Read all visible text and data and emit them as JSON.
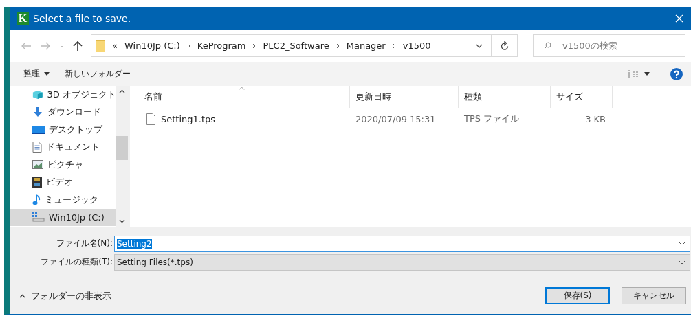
{
  "window": {
    "title": "Select a file to save.",
    "app_icon_letter": "K"
  },
  "address_bar": {
    "overflow": "«",
    "crumbs": [
      "Win10Jp (C:)",
      "KeProgram",
      "PLC2_Software",
      "Manager",
      "v1500"
    ]
  },
  "search": {
    "placeholder": "v1500の検索"
  },
  "toolbar": {
    "organize": "整理",
    "new_folder": "新しいフォルダー"
  },
  "sidebar": {
    "items": [
      {
        "label": "3D オブジェクト",
        "kind": "objects",
        "selected": false
      },
      {
        "label": "ダウンロード",
        "kind": "downloads",
        "selected": false
      },
      {
        "label": "デスクトップ",
        "kind": "desktop",
        "selected": false
      },
      {
        "label": "ドキュメント",
        "kind": "documents",
        "selected": false
      },
      {
        "label": "ピクチャ",
        "kind": "pictures",
        "selected": false
      },
      {
        "label": "ビデオ",
        "kind": "videos",
        "selected": false
      },
      {
        "label": "ミュージック",
        "kind": "music",
        "selected": false
      },
      {
        "label": "Win10Jp (C:)",
        "kind": "drive",
        "selected": true
      }
    ]
  },
  "table": {
    "columns": [
      {
        "label": "名前",
        "sorted": true
      },
      {
        "label": "更新日時",
        "sorted": false
      },
      {
        "label": "種類",
        "sorted": false
      },
      {
        "label": "サイズ",
        "sorted": false
      }
    ],
    "rows": [
      {
        "name": "Setting1.tps",
        "modified": "2020/07/09 15:31",
        "type": "TPS ファイル",
        "size": "3 KB"
      }
    ]
  },
  "filename": {
    "label": "ファイル名(N):",
    "value": "Setting2",
    "text_selected": true
  },
  "filetype": {
    "label": "ファイルの種類(T):",
    "value": "Setting Files(*.tps)"
  },
  "hide_folders": "フォルダーの非表示",
  "buttons": [
    {
      "label": "保存(S)",
      "default": true
    },
    {
      "label": "キャンセル",
      "default": false
    }
  ]
}
